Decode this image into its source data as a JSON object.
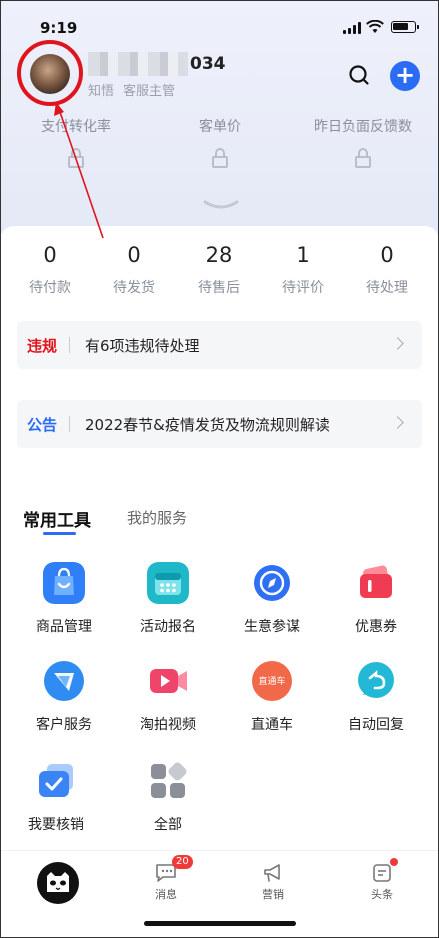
{
  "status": {
    "time": "9:19"
  },
  "header": {
    "store_name_suffix": "034",
    "role_a": "知悟",
    "role_b": "客服主管"
  },
  "metrics": [
    {
      "label": "支付转化率"
    },
    {
      "label": "客单价"
    },
    {
      "label": "昨日负面反馈数"
    }
  ],
  "orders": [
    {
      "count": "0",
      "label": "待付款"
    },
    {
      "count": "0",
      "label": "待发货"
    },
    {
      "count": "28",
      "label": "待售后"
    },
    {
      "count": "1",
      "label": "待评价"
    },
    {
      "count": "0",
      "label": "待处理"
    }
  ],
  "notices": [
    {
      "tag": "违规",
      "text": "有6项违规待处理",
      "tag_color": "#e0141c"
    },
    {
      "tag": "公告",
      "text": "2022春节&疫情发货及物流规则解读",
      "tag_color": "#2a6cf6"
    }
  ],
  "tabs": {
    "common": "常用工具",
    "my_services": "我的服务"
  },
  "tools": [
    {
      "label": "商品管理",
      "icon": "bag-icon",
      "color": "#2f7ff8"
    },
    {
      "label": "活动报名",
      "icon": "calendar-icon",
      "color": "#1fb8c9"
    },
    {
      "label": "生意参谋",
      "icon": "compass-icon",
      "color": "#2f6ff4"
    },
    {
      "label": "优惠券",
      "icon": "coupon-icon",
      "color": "#ef3c52"
    },
    {
      "label": "客户服务",
      "icon": "customer-service-icon",
      "color": "#2f8cf3"
    },
    {
      "label": "淘拍视频",
      "icon": "video-icon",
      "color": "#f0456a"
    },
    {
      "label": "直通车",
      "icon": "express-train-icon",
      "color": "#f2694a",
      "inner_text": "直通车"
    },
    {
      "label": "自动回复",
      "icon": "auto-reply-icon",
      "color": "#22b8d6"
    },
    {
      "label": "我要核销",
      "icon": "verify-icon",
      "color": "#3a84f5"
    },
    {
      "label": "全部",
      "icon": "all-apps-icon",
      "color": "#9ea3ab"
    }
  ],
  "tabbar": {
    "items": [
      {
        "label": "消息",
        "badge": "20"
      },
      {
        "label": "营销"
      },
      {
        "label": "头条"
      }
    ]
  },
  "colors": {
    "accent": "#2a6cf6",
    "alert": "#e0141c"
  }
}
